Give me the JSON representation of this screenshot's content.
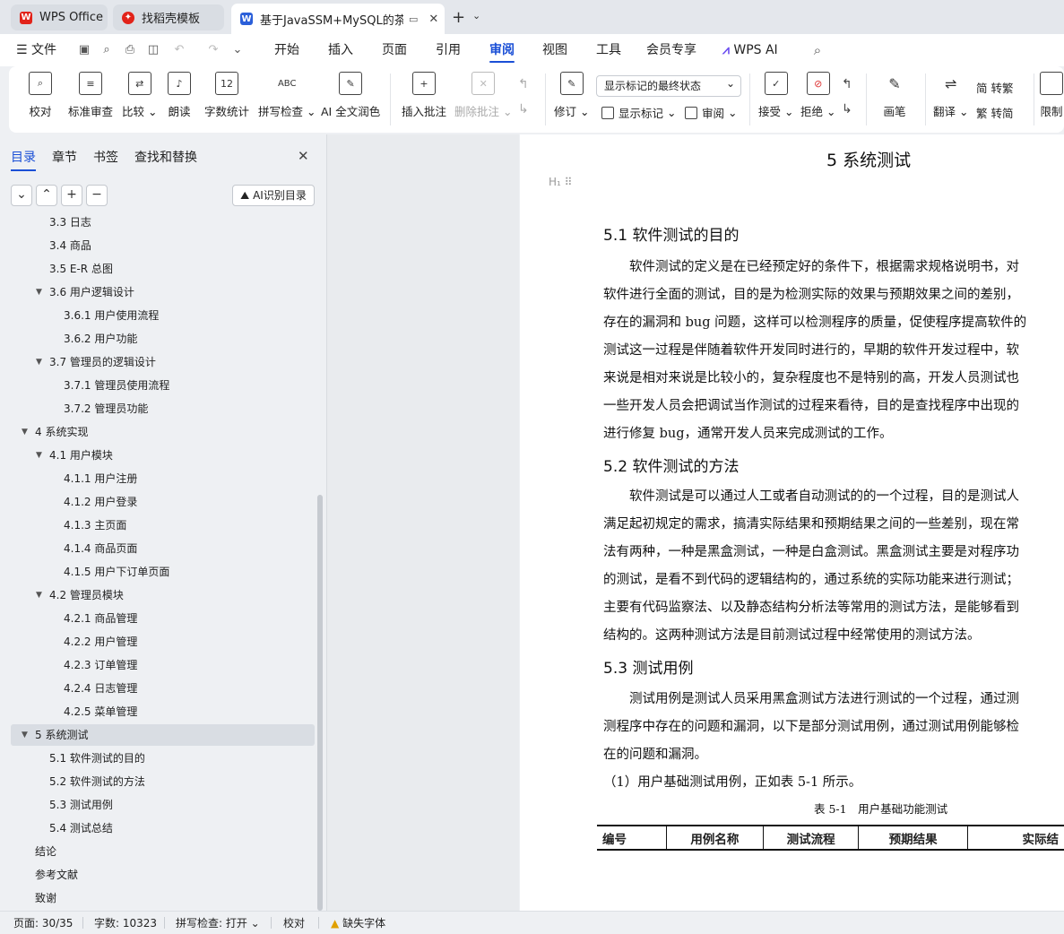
{
  "tabs": [
    {
      "label": "WPS Office"
    },
    {
      "label": "找稻壳模板"
    },
    {
      "label": "基于JavaSSM+MySQL的茶"
    }
  ],
  "menu": {
    "file": "文件",
    "items": [
      "开始",
      "插入",
      "页面",
      "引用",
      "审阅",
      "视图",
      "工具",
      "会员专享"
    ],
    "active": "审阅",
    "wps_ai": "WPS AI"
  },
  "ribbon": {
    "proofread": "校对",
    "standard_review": "标准审查",
    "compare": "比较",
    "read_aloud": "朗读",
    "word_count": "字数统计",
    "spell_check": "拼写检查",
    "ai_polish": "AI 全文润色",
    "insert_comment": "插入批注",
    "delete_comment": "删除批注",
    "track_changes": "修订",
    "markup_mode": "显示标记的最终状态",
    "show_markup": "显示标记",
    "review": "审阅",
    "accept": "接受",
    "reject": "拒绝",
    "pen": "画笔",
    "translate": "翻译",
    "to_traditional": "简 转繁",
    "to_simplified": "繁 转简",
    "restrict": "限制"
  },
  "left_panel": {
    "tabs": [
      "目录",
      "章节",
      "书签",
      "查找和替换"
    ],
    "active_tab": "目录",
    "ai_button": "AI识别目录",
    "toc": [
      {
        "label": "3.3 日志",
        "level": 2
      },
      {
        "label": "3.4 商品",
        "level": 2
      },
      {
        "label": "3.5 E-R 总图",
        "level": 2
      },
      {
        "label": "3.6 用户逻辑设计",
        "level": 2,
        "expanded": true
      },
      {
        "label": "3.6.1 用户使用流程",
        "level": 3
      },
      {
        "label": "3.6.2 用户功能",
        "level": 3
      },
      {
        "label": "3.7 管理员的逻辑设计",
        "level": 2,
        "expanded": true
      },
      {
        "label": "3.7.1 管理员使用流程",
        "level": 3
      },
      {
        "label": "3.7.2 管理员功能",
        "level": 3
      },
      {
        "label": "4 系统实现",
        "level": 1,
        "expanded": true
      },
      {
        "label": "4.1 用户模块",
        "level": 2,
        "expanded": true
      },
      {
        "label": "4.1.1 用户注册",
        "level": 3
      },
      {
        "label": "4.1.2 用户登录",
        "level": 3
      },
      {
        "label": "4.1.3 主页面",
        "level": 3
      },
      {
        "label": "4.1.4 商品页面",
        "level": 3
      },
      {
        "label": "4.1.5 用户下订单页面",
        "level": 3
      },
      {
        "label": "4.2 管理员模块",
        "level": 2,
        "expanded": true
      },
      {
        "label": "4.2.1 商品管理",
        "level": 3
      },
      {
        "label": "4.2.2 用户管理",
        "level": 3
      },
      {
        "label": "4.2.3 订单管理",
        "level": 3
      },
      {
        "label": "4.2.4 日志管理",
        "level": 3
      },
      {
        "label": "4.2.5 菜单管理",
        "level": 3
      },
      {
        "label": "5 系统测试",
        "level": 1,
        "expanded": true,
        "selected": true
      },
      {
        "label": "5.1 软件测试的目的",
        "level": 2
      },
      {
        "label": "5.2 软件测试的方法",
        "level": 2
      },
      {
        "label": "5.3 测试用例",
        "level": 2
      },
      {
        "label": "5.4 测试总结",
        "level": 2
      },
      {
        "label": "结论",
        "level": 1
      },
      {
        "label": "参考文献",
        "level": 1
      },
      {
        "label": "致谢",
        "level": 1
      }
    ]
  },
  "document": {
    "h1": "5  系统测试",
    "h1_marker": "H₁",
    "s1_title": "5.1  软件测试的目的",
    "s1_lines": [
      "　　软件测试的定义是在已经预定好的条件下，根据需求规格说明书，对",
      "软件进行全面的测试，目的是为检测实际的效果与预期效果之间的差别，",
      "存在的漏洞和 bug 问题，这样可以检测程序的质量，促使程序提高软件的",
      "测试这一过程是伴随着软件开发同时进行的，早期的软件开发过程中，软",
      "来说是相对来说是比较小的，复杂程度也不是特别的高，开发人员测试也",
      "一些开发人员会把调试当作测试的过程来看待，目的是查找程序中出现的",
      "进行修复 bug，通常开发人员来完成测试的工作。"
    ],
    "s2_title": "5.2  软件测试的方法",
    "s2_lines": [
      "　　软件测试是可以通过人工或者自动测试的的一个过程，目的是测试人",
      "满足起初规定的需求，搞清实际结果和预期结果之间的一些差别，现在常",
      "法有两种，一种是黑盒测试，一种是白盒测试。黑盒测试主要是对程序功",
      "的测试，是看不到代码的逻辑结构的，通过系统的实际功能来进行测试；",
      "主要有代码监察法、以及静态结构分析法等常用的测试方法，是能够看到",
      "结构的。这两种测试方法是目前测试过程中经常使用的测试方法。"
    ],
    "s3_title": "5.3  测试用例",
    "s3_lines": [
      "　　测试用例是测试人员采用黑盒测试方法进行测试的一个过程，通过测",
      "测程序中存在的问题和漏洞，以下是部分测试用例，通过测试用例能够检",
      "在的问题和漏洞。",
      "（1）用户基础测试用例，正如表 5-1 所示。"
    ],
    "table_caption": "表 5-1　用户基础功能测试",
    "table_headers": [
      "编号",
      "用例名称",
      "测试流程",
      "预期结果",
      "实际结"
    ]
  },
  "status": {
    "page": "页面: 30/35",
    "word_count": "字数: 10323",
    "spell_check": "拼写检查: 打开 ⌄",
    "proofread": "校对",
    "missing_font": "缺失字体"
  },
  "colors": {
    "accent": "#1a4fd6",
    "wps_red": "#e2231a",
    "word_blue": "#2b5fd9"
  }
}
